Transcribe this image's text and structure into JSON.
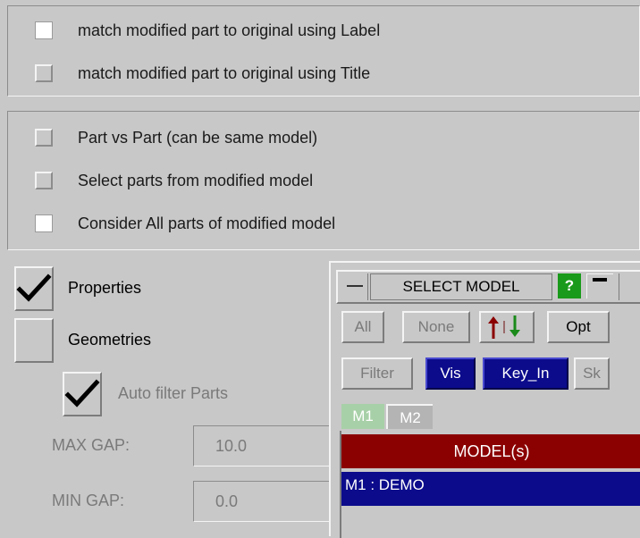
{
  "match_options": [
    {
      "label": "match modified part to original using Label",
      "checked": true
    },
    {
      "label": "match modified part to original using Title",
      "checked": false
    }
  ],
  "part_options": [
    {
      "label": "Part vs Part (can be same model)",
      "checked": false
    },
    {
      "label": "Select parts from modified model",
      "checked": false
    },
    {
      "label": "Consider All parts of modified model",
      "checked": true
    }
  ],
  "compare": {
    "properties_label": "Properties",
    "properties_checked": true,
    "geometries_label": "Geometries",
    "geometries_checked": false,
    "auto_filter_label": "Auto filter Parts",
    "auto_filter_checked": true
  },
  "gaps": {
    "max_label": "MAX GAP:",
    "max_value": "10.0",
    "min_label": "MIN GAP:",
    "min_value": "0.0"
  },
  "select_model": {
    "title": "SELECT MODEL",
    "help_label": "?",
    "buttons": {
      "all": "All",
      "none": "None",
      "opt": "Opt",
      "filter": "Filter",
      "vis": "Vis",
      "key_in": "Key_In",
      "sk": "Sk"
    },
    "tabs": [
      "M1",
      "M2"
    ],
    "list_header": "MODEL(s)",
    "list_items": [
      "M1 : DEMO"
    ]
  },
  "colors": {
    "background": "#c8c8c8",
    "list_header": "#8b0000",
    "selected_item": "#0b0b8c",
    "help_green": "#1a9a1a",
    "tab_green": "#a8d0a8"
  }
}
